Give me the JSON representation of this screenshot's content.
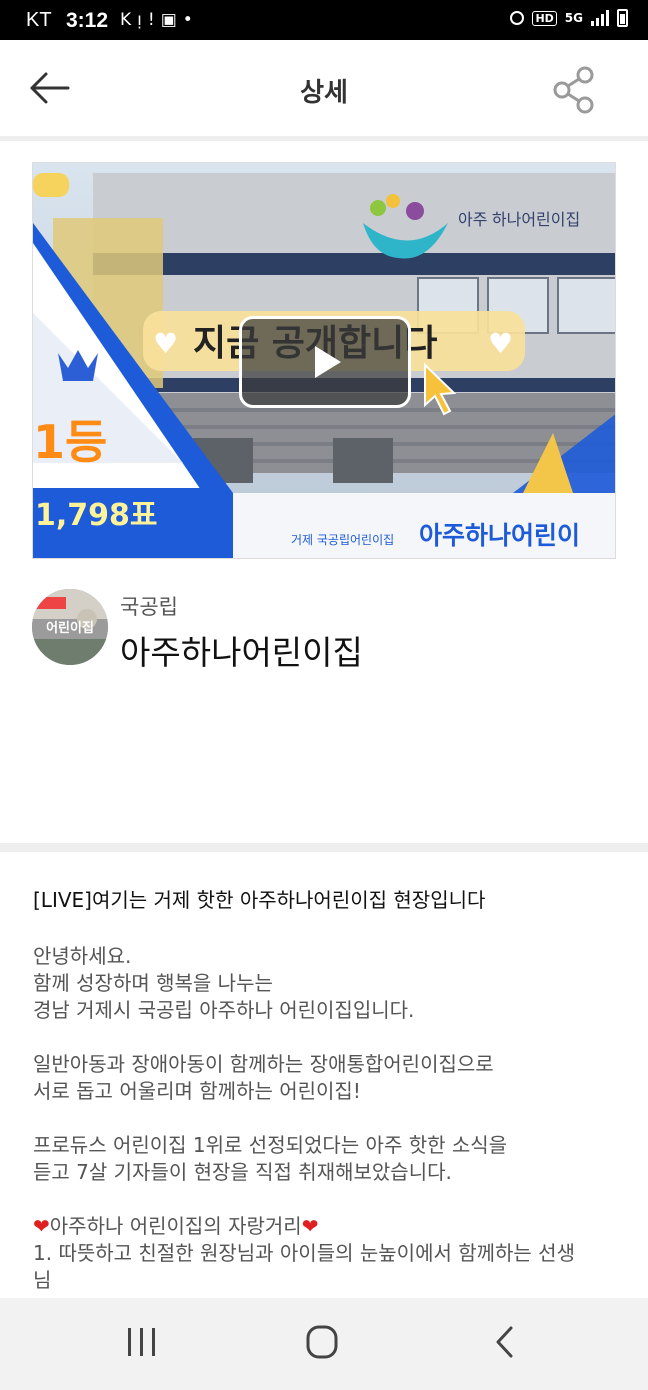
{
  "status_bar": {
    "carrier": "KT",
    "time": "3:12",
    "hd_label": "HD",
    "network_label": "5G"
  },
  "header": {
    "title": "상세"
  },
  "video": {
    "overlay_headline": "지금 공개합니다",
    "rank_label": "1등",
    "vote_count": "1,798표",
    "building_sign": "아주 하나어린이집",
    "banner_small": "거제 국공립어린이집",
    "banner_large": "아주하나어린이"
  },
  "profile": {
    "avatar_text": "어린이집",
    "category": "국공립",
    "name": "아주하나어린이집"
  },
  "description": {
    "title": "[LIVE]여기는 거제 핫한 아주하나어린이집 현장입니다",
    "p1": [
      "안녕하세요.",
      "함께 성장하며 행복을 나누는",
      "경남 거제시 국공립 아주하나 어린이집입니다."
    ],
    "p2": [
      "일반아동과 장애아동이 함께하는 장애통합어린이집으로",
      "서로 돕고 어울리며 함께하는 어린이집!"
    ],
    "p3": [
      "프로듀스 어린이집 1위로 선정되었다는 아주 핫한 소식을",
      "듣고 7살 기자들이 현장을 직접 취재해보았습니다."
    ],
    "p4_heading": "아주하나 어린이집의 자랑거리",
    "p4_line1": "1. 따뜻하고 친절한 원장님과 아이들의 눈높이에서 함께하는 선생",
    "p4_line2": "님"
  }
}
